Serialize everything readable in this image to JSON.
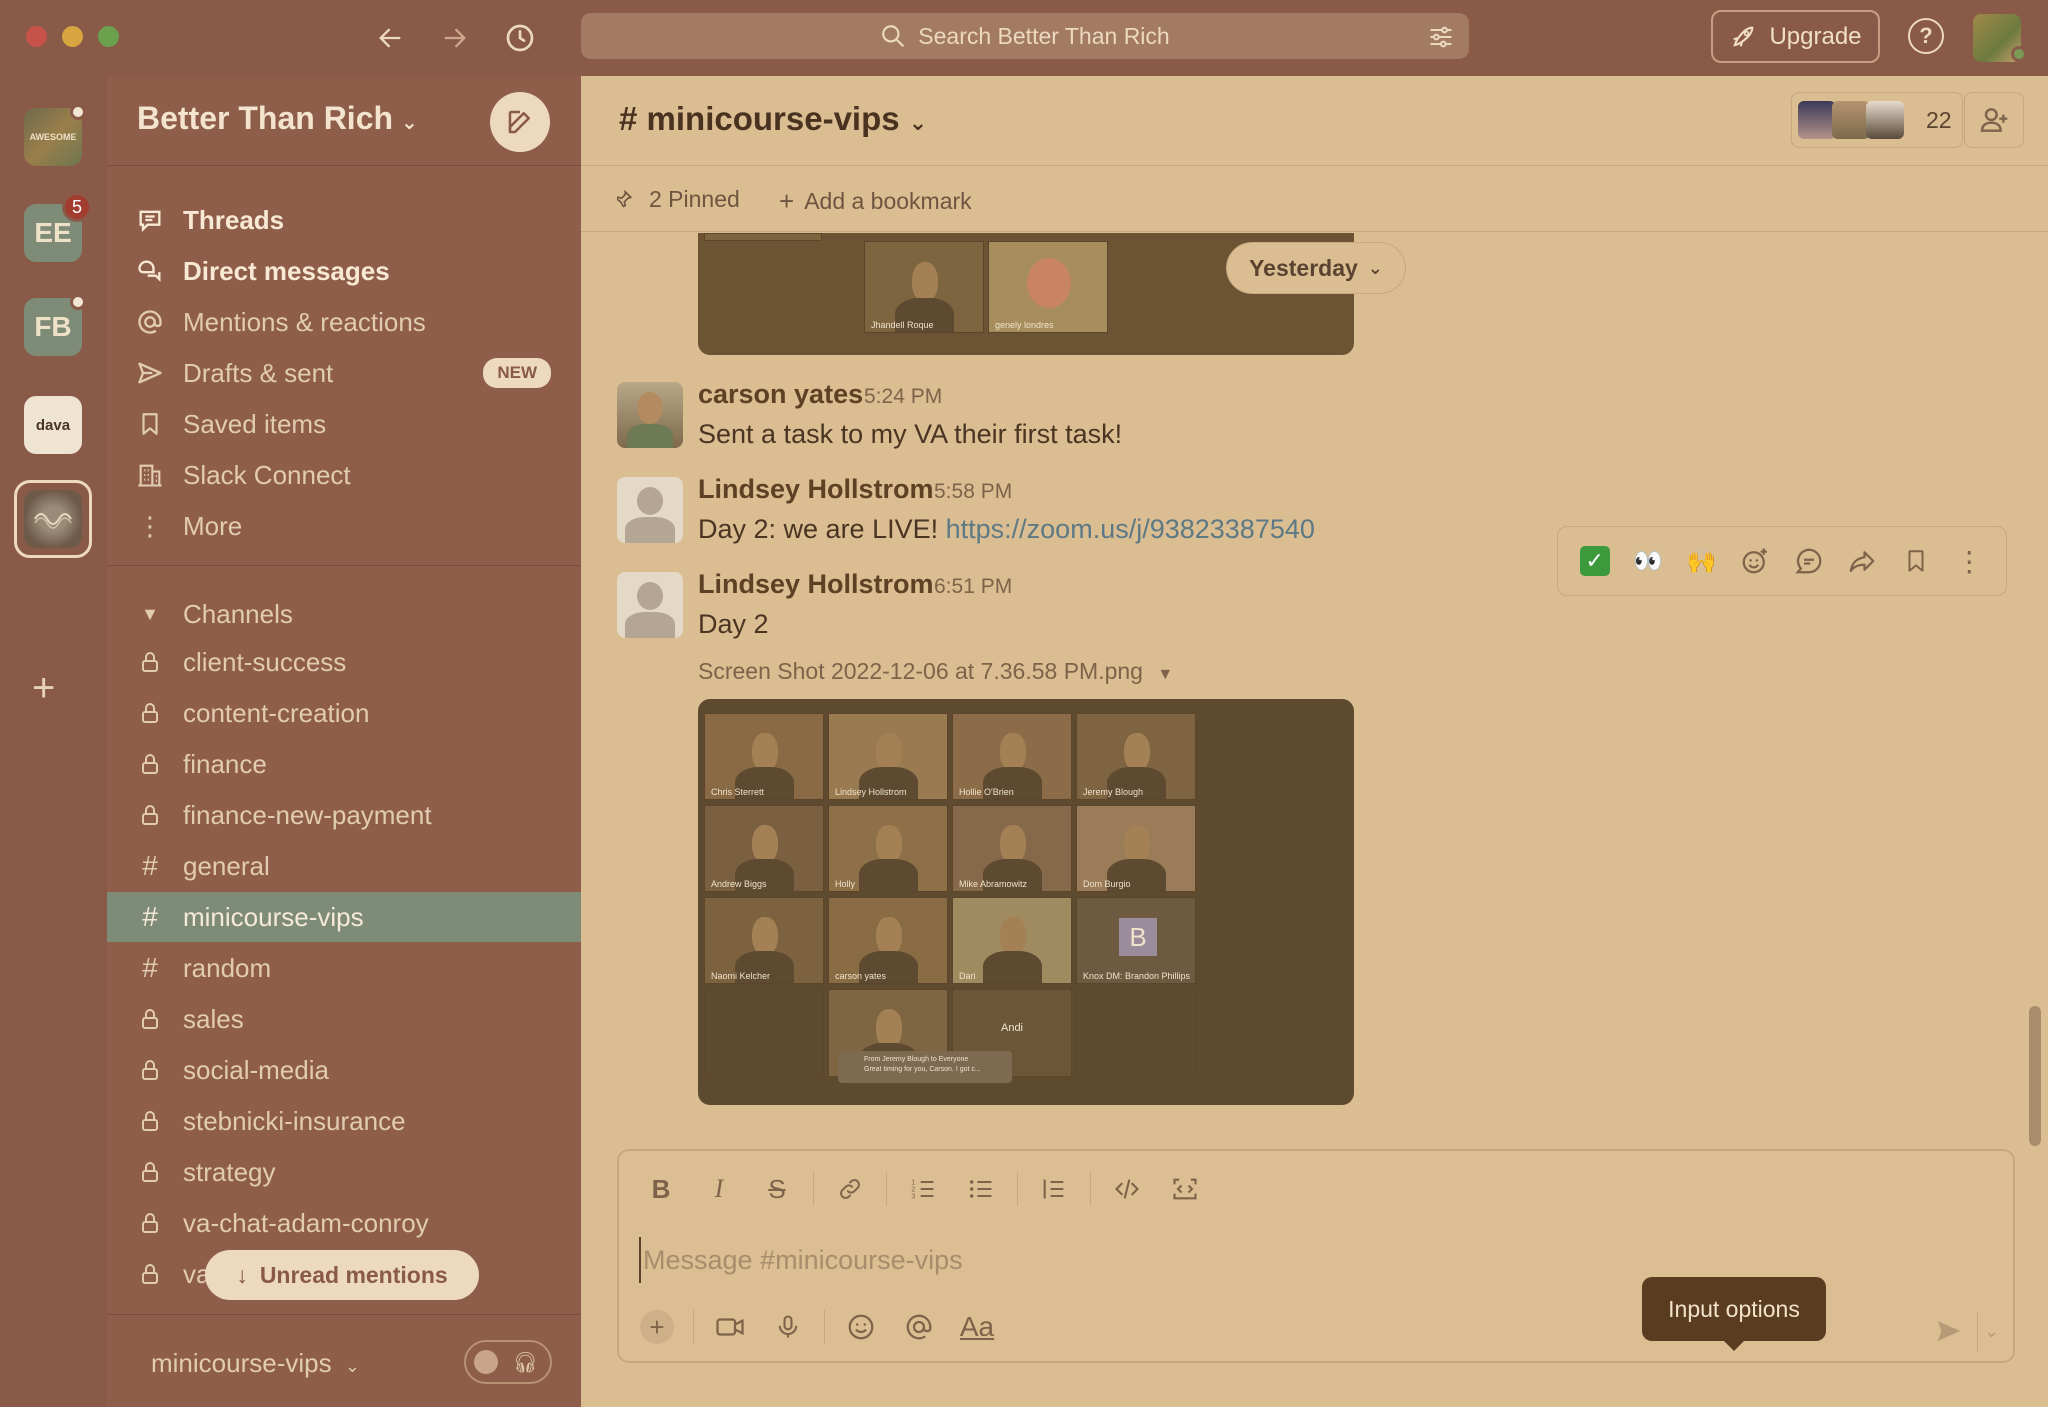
{
  "titlebar": {
    "search_placeholder": "Search Better Than Rich",
    "upgrade_label": "Upgrade",
    "help_label": "?"
  },
  "rail": {
    "workspaces": [
      {
        "label": "AWESOME",
        "has_dot": true
      },
      {
        "label": "EE",
        "badge": "5"
      },
      {
        "label": "FB",
        "has_dot": true
      },
      {
        "label": "dava"
      },
      {
        "label": "",
        "active": true
      }
    ]
  },
  "sidebar": {
    "workspace_name": "Better Than Rich",
    "nav": [
      {
        "label": "Threads",
        "icon": "threads-icon",
        "bold": true
      },
      {
        "label": "Direct messages",
        "icon": "direct-messages-icon",
        "bold": true
      },
      {
        "label": "Mentions & reactions",
        "icon": "at-icon",
        "bold": false
      },
      {
        "label": "Drafts & sent",
        "icon": "send-icon",
        "bold": false,
        "badge": "NEW"
      },
      {
        "label": "Saved items",
        "icon": "bookmark-icon",
        "bold": false
      },
      {
        "label": "Slack Connect",
        "icon": "building-icon",
        "bold": false
      },
      {
        "label": "More",
        "icon": "more-vertical-icon",
        "bold": false
      }
    ],
    "channels_header": "Channels",
    "channels": [
      {
        "name": "client-success",
        "private": true
      },
      {
        "name": "content-creation",
        "private": true
      },
      {
        "name": "finance",
        "private": true
      },
      {
        "name": "finance-new-payment",
        "private": true
      },
      {
        "name": "general",
        "private": false
      },
      {
        "name": "minicourse-vips",
        "private": false,
        "active": true
      },
      {
        "name": "random",
        "private": false
      },
      {
        "name": "sales",
        "private": true
      },
      {
        "name": "social-media",
        "private": true
      },
      {
        "name": "stebnicki-insurance",
        "private": true
      },
      {
        "name": "strategy",
        "private": true
      },
      {
        "name": "va-chat-adam-conroy",
        "private": true
      },
      {
        "name": "va",
        "private": true
      }
    ],
    "unread_mentions_label": "Unread mentions",
    "footer_channel": "minicourse-vips"
  },
  "channel": {
    "title": "minicourse-vips",
    "member_count": "22",
    "pinned_label": "2 Pinned",
    "add_bookmark_label": "Add a bookmark",
    "date_divider": "Yesterday"
  },
  "messages": [
    {
      "author": "carson yates",
      "time": "5:24 PM",
      "text": "Sent a task to my VA their first task!"
    },
    {
      "author": "Lindsey Hollstrom",
      "time": "5:58 PM",
      "text": "Day 2: we are LIVE! ",
      "link": "https://zoom.us/j/93823387540"
    },
    {
      "author": "Lindsey Hollstrom",
      "time": "6:51 PM",
      "text": "Day 2",
      "file": "Screen Shot 2022-12-06 at 7.36.58 PM.png"
    }
  ],
  "top_thumb_names": [
    "Jhandell Roque",
    "genely londres"
  ],
  "zoom_grid": [
    "Chris Sterrett",
    "Lindsey Hollstrom",
    "Hollie O'Brien",
    "Jeremy Blough",
    "Andrew Biggs",
    "Holly",
    "Mike Abramowitz",
    "Dom Burgio",
    "Naomi Kelcher",
    "carson yates",
    "Dari",
    "Knox DM: Brandon Phillips",
    "",
    "",
    "Andi",
    ""
  ],
  "zoom_misc": {
    "tile_letter": "B",
    "andi_center": "Andi",
    "chat_from": "From Jeremy Blough to Everyone",
    "chat_text": "Great timing for you, Carson. I got c..."
  },
  "composer": {
    "placeholder": "Message #minicourse-vips",
    "tooltip": "Input options"
  },
  "colors": {
    "sidebar_bg": "#8e5e4b",
    "main_bg": "#dbbd92",
    "active_channel": "#7e8c77",
    "link": "#5d7984",
    "checkmark": "#3c9a3c"
  }
}
